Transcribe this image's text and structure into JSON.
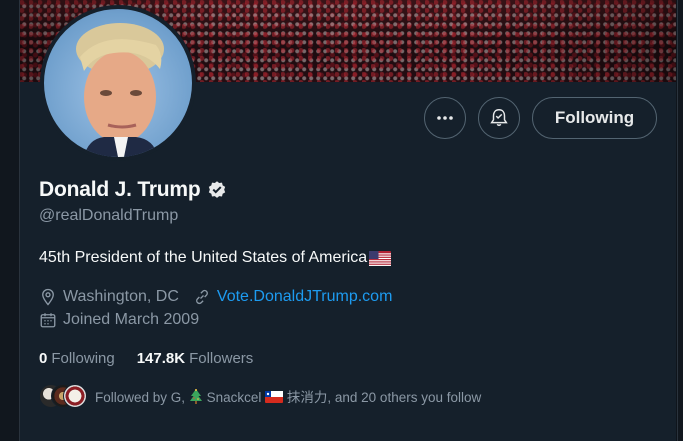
{
  "profile": {
    "name": "Donald J. Trump",
    "handle": "@realDonaldTrump",
    "bio": "45th President of the United States of America",
    "location": "Washington, DC",
    "website": "Vote.DonaldJTrump.com",
    "joined": "Joined March 2009",
    "verified": true
  },
  "actions": {
    "more_icon": "ellipsis-icon",
    "notify_icon": "bell-check-icon",
    "follow_label": "Following"
  },
  "stats": {
    "following_count": "0",
    "following_label": "Following",
    "followers_count": "147.8K",
    "followers_label": "Followers"
  },
  "followed_by": {
    "prefix": "Followed by G,",
    "name2": "Snackcel",
    "name3": "抹消力, and 20 others you follow"
  },
  "colors": {
    "background": "#15202b",
    "link": "#1d9bf0",
    "muted": "#8b98a5",
    "verified_badge": "#e7e9ea"
  }
}
